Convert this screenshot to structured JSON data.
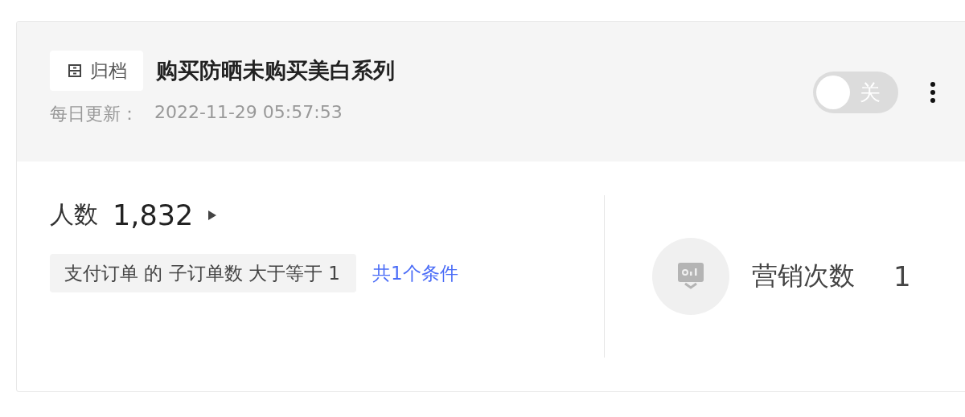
{
  "header": {
    "tag": {
      "label": "归档"
    },
    "title": "购买防晒未购买美白系列",
    "update_label": "每日更新：",
    "update_time": "2022-11-29 05:57:53",
    "toggle": {
      "on": false,
      "label": "关"
    }
  },
  "audience": {
    "label": "人数",
    "count": "1,832",
    "condition": "支付订单 的 子订单数 大于等于 1",
    "conditions_link": "共1个条件"
  },
  "marketing": {
    "label": "营销次数",
    "count": "1"
  }
}
